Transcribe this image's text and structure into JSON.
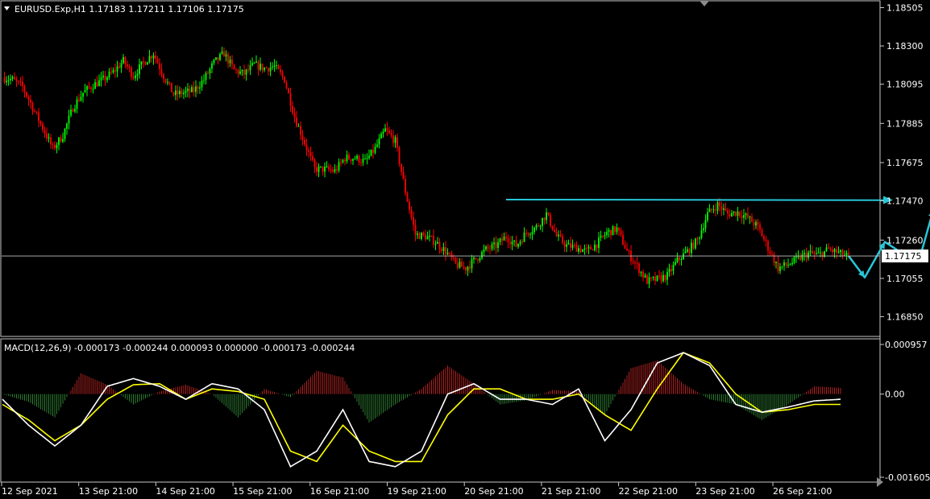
{
  "header": {
    "symbol_line": "EURUSD.Exp,H1  1.17183 1.17211 1.17106 1.17175",
    "macd_line": "MACD(12,26,9) -0.000173 -0.000244 0.000093 0.000000 -0.000173 -0.000244"
  },
  "colors": {
    "background": "#000000",
    "bull_candle": "#00ff00",
    "bear_candle": "#ff0000",
    "hist_positive": "#b22222",
    "hist_negative": "#2e7d32",
    "macd_line": "#ffffff",
    "signal_line": "#ffff00",
    "projection": "#27c6d8",
    "price_line": "#c0c0c0"
  },
  "chart_data": [
    {
      "type": "candlestick",
      "y_ticks": [
        "1.18505",
        "1.18300",
        "1.18095",
        "1.17885",
        "1.17675",
        "1.17470",
        "1.17260",
        "1.17055",
        "1.16850"
      ],
      "y_range": [
        1.1677,
        1.1852
      ],
      "current_price": "1.17175",
      "x_ticks": [
        "12 Sep 2021",
        "13 Sep 21:00",
        "14 Sep 21:00",
        "15 Sep 21:00",
        "16 Sep 21:00",
        "19 Sep 21:00",
        "20 Sep 21:00",
        "21 Sep 21:00",
        "22 Sep 21:00",
        "23 Sep 21:00",
        "26 Sep 21:00"
      ],
      "close_path": [
        [
          0,
          1.1813
        ],
        [
          5,
          1.1812
        ],
        [
          10,
          1.1808
        ],
        [
          15,
          1.1797
        ],
        [
          20,
          1.1786
        ],
        [
          25,
          1.1775
        ],
        [
          30,
          1.1782
        ],
        [
          35,
          1.1797
        ],
        [
          40,
          1.1805
        ],
        [
          45,
          1.1809
        ],
        [
          50,
          1.1812
        ],
        [
          55,
          1.1816
        ],
        [
          60,
          1.1822
        ],
        [
          65,
          1.1814
        ],
        [
          70,
          1.1821
        ],
        [
          75,
          1.1826
        ],
        [
          80,
          1.1814
        ],
        [
          85,
          1.1804
        ],
        [
          90,
          1.1805
        ],
        [
          95,
          1.1806
        ],
        [
          100,
          1.1812
        ],
        [
          105,
          1.1821
        ],
        [
          110,
          1.1826
        ],
        [
          115,
          1.1817
        ],
        [
          120,
          1.1815
        ],
        [
          125,
          1.182
        ],
        [
          130,
          1.1818
        ],
        [
          135,
          1.1819
        ],
        [
          140,
          1.1812
        ],
        [
          145,
          1.1792
        ],
        [
          150,
          1.1778
        ],
        [
          155,
          1.1764
        ],
        [
          160,
          1.1764
        ],
        [
          165,
          1.1763
        ],
        [
          170,
          1.177
        ],
        [
          175,
          1.177
        ],
        [
          180,
          1.1768
        ],
        [
          185,
          1.1775
        ],
        [
          190,
          1.1785
        ],
        [
          195,
          1.1779
        ],
        [
          200,
          1.1752
        ],
        [
          205,
          1.1729
        ],
        [
          210,
          1.1728
        ],
        [
          215,
          1.1725
        ],
        [
          220,
          1.172
        ],
        [
          225,
          1.1713
        ],
        [
          230,
          1.1711
        ],
        [
          235,
          1.1716
        ],
        [
          240,
          1.1721
        ],
        [
          245,
          1.1723
        ],
        [
          250,
          1.1728
        ],
        [
          255,
          1.1723
        ],
        [
          260,
          1.173
        ],
        [
          265,
          1.1733
        ],
        [
          270,
          1.174
        ],
        [
          275,
          1.1728
        ],
        [
          280,
          1.1723
        ],
        [
          285,
          1.1722
        ],
        [
          290,
          1.172
        ],
        [
          295,
          1.1724
        ],
        [
          300,
          1.173
        ],
        [
          305,
          1.1732
        ],
        [
          310,
          1.172
        ],
        [
          315,
          1.1712
        ],
        [
          320,
          1.1704
        ],
        [
          325,
          1.1705
        ],
        [
          330,
          1.1707
        ],
        [
          335,
          1.1715
        ],
        [
          340,
          1.172
        ],
        [
          345,
          1.1726
        ],
        [
          350,
          1.174
        ],
        [
          355,
          1.1745
        ],
        [
          360,
          1.174
        ],
        [
          365,
          1.1741
        ],
        [
          370,
          1.1738
        ],
        [
          375,
          1.1733
        ],
        [
          380,
          1.1722
        ],
        [
          385,
          1.1711
        ],
        [
          390,
          1.1713
        ],
        [
          395,
          1.1716
        ],
        [
          400,
          1.1719
        ],
        [
          405,
          1.1718
        ],
        [
          410,
          1.1721
        ],
        [
          415,
          1.1719
        ],
        [
          420,
          1.1717
        ]
      ]
    },
    {
      "type": "line",
      "title": "MACD(12,26,9)",
      "y_ticks": [
        "0.000957",
        "0.00",
        "-0.001605"
      ],
      "y_range": [
        -0.001605,
        0.000957
      ],
      "series": [
        {
          "role": "histogram",
          "points": [
            [
              0,
              0
            ],
            [
              13,
              -0.00015
            ],
            [
              26,
              -0.00045
            ],
            [
              39,
              0.0004
            ],
            [
              52,
              0.00018
            ],
            [
              65,
              -0.0002
            ],
            [
              78,
              5e-05
            ],
            [
              91,
              0.00018
            ],
            [
              104,
              0.0
            ],
            [
              117,
              -0.00045
            ],
            [
              130,
              0.0001
            ],
            [
              143,
              -6e-05
            ],
            [
              156,
              0.00045
            ],
            [
              169,
              0.00032
            ],
            [
              182,
              -0.00055
            ],
            [
              195,
              -0.0002
            ],
            [
              208,
              0.0001
            ],
            [
              221,
              0.00055
            ],
            [
              234,
              0.0002
            ],
            [
              247,
              -0.0002
            ],
            [
              260,
              -0.00012
            ],
            [
              273,
              8e-05
            ],
            [
              286,
              5e-05
            ],
            [
              299,
              -0.0004
            ],
            [
              312,
              0.0005
            ],
            [
              325,
              0.00065
            ],
            [
              338,
              0.0002
            ],
            [
              351,
              -0.0001
            ],
            [
              364,
              -0.0002
            ],
            [
              377,
              -0.0005
            ],
            [
              390,
              -0.0002
            ],
            [
              403,
              0.00015
            ],
            [
              416,
              0.00012
            ]
          ]
        },
        {
          "role": "macd",
          "points": [
            [
              0,
              -0.0001
            ],
            [
              13,
              -0.0006
            ],
            [
              26,
              -0.001
            ],
            [
              39,
              -0.0006
            ],
            [
              52,
              0.00015
            ],
            [
              65,
              0.0003
            ],
            [
              78,
              0.00015
            ],
            [
              91,
              -0.0001
            ],
            [
              104,
              0.0002
            ],
            [
              117,
              0.0001
            ],
            [
              130,
              -0.0003
            ],
            [
              143,
              -0.0014
            ],
            [
              156,
              -0.0011
            ],
            [
              169,
              -0.0003
            ],
            [
              182,
              -0.0013
            ],
            [
              195,
              -0.0014
            ],
            [
              208,
              -0.0011
            ],
            [
              221,
              0.0
            ],
            [
              234,
              0.0002
            ],
            [
              247,
              -0.0001
            ],
            [
              260,
              -0.0001
            ],
            [
              273,
              -0.0002
            ],
            [
              286,
              0.0001
            ],
            [
              299,
              -0.0009
            ],
            [
              312,
              -0.0003
            ],
            [
              325,
              0.0006
            ],
            [
              338,
              0.0008
            ],
            [
              351,
              0.00055
            ],
            [
              364,
              -0.0002
            ],
            [
              377,
              -0.00035
            ],
            [
              390,
              -0.00025
            ],
            [
              403,
              -0.00013
            ],
            [
              416,
              -0.0001
            ]
          ]
        },
        {
          "role": "signal",
          "points": [
            [
              0,
              -0.0002
            ],
            [
              13,
              -0.0005
            ],
            [
              26,
              -0.0009
            ],
            [
              39,
              -0.0006
            ],
            [
              52,
              -0.0001
            ],
            [
              65,
              0.00018
            ],
            [
              78,
              0.0002
            ],
            [
              91,
              -0.0001
            ],
            [
              104,
              0.0001
            ],
            [
              117,
              5e-05
            ],
            [
              130,
              -0.0001
            ],
            [
              143,
              -0.0011
            ],
            [
              156,
              -0.0013
            ],
            [
              169,
              -0.0006
            ],
            [
              182,
              -0.0011
            ],
            [
              195,
              -0.0013
            ],
            [
              208,
              -0.0013
            ],
            [
              221,
              -0.0004
            ],
            [
              234,
              0.0001
            ],
            [
              247,
              0.0001
            ],
            [
              260,
              -0.0001
            ],
            [
              273,
              -0.0001
            ],
            [
              286,
              0.0
            ],
            [
              299,
              -0.0004
            ],
            [
              312,
              -0.0007
            ],
            [
              325,
              0.0001
            ],
            [
              338,
              0.0008
            ],
            [
              351,
              0.0006
            ],
            [
              364,
              0.0
            ],
            [
              377,
              -0.00035
            ],
            [
              390,
              -0.0003
            ],
            [
              403,
              -0.0002
            ],
            [
              416,
              -0.0002
            ]
          ]
        }
      ]
    },
    {
      "type": "line",
      "role": "projection",
      "resistance_level": 1.17475,
      "path": [
        [
          420,
          1.17175
        ],
        [
          428,
          1.1706
        ],
        [
          438,
          1.1725
        ],
        [
          448,
          1.1718
        ],
        [
          456,
          1.1719
        ],
        [
          462,
          1.1742
        ],
        [
          468,
          1.1737
        ],
        [
          474,
          1.1732
        ],
        [
          480,
          1.173
        ],
        [
          486,
          1.1776
        ]
      ]
    }
  ]
}
